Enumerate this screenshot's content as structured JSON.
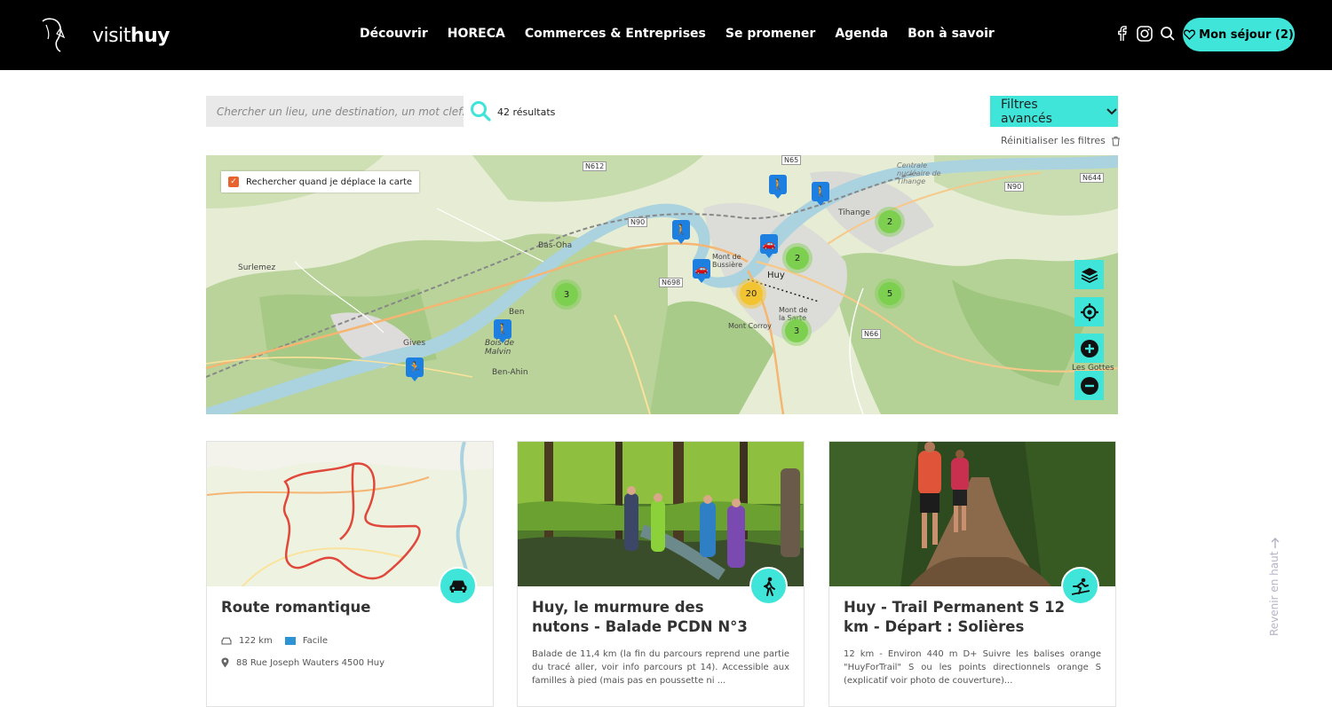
{
  "brand": {
    "logo_prefix": "visit",
    "logo_suffix": "huy"
  },
  "nav": {
    "items": [
      "Découvrir",
      "HORECA",
      "Commerces & Entreprises",
      "Se promener",
      "Agenda",
      "Bon à savoir"
    ]
  },
  "header": {
    "icons": [
      "facebook-icon",
      "instagram-icon",
      "search-icon"
    ],
    "sejour_label": "Mon séjour (2)"
  },
  "search": {
    "placeholder": "Chercher un lieu, une destination, un mot clef...",
    "results": "42 résultats",
    "filters_label": "Filtres avancés",
    "reset_label": "Réinitialiser les filtres"
  },
  "map": {
    "checkbox_label": "Rechercher quand je déplace la carte",
    "places": [
      "Surlemez",
      "Bas-Oha",
      "Ben",
      "Gives",
      "Bois de Malvin",
      "Ben-Ahin",
      "Huy",
      "Mont de Bussière",
      "Mont de la Sarte",
      "Mont Corroy",
      "Tihange",
      "Centrale nucléaire de Tihange",
      "Les Gottes"
    ],
    "roads": [
      "N612",
      "N90",
      "N698",
      "N65",
      "N90",
      "N644",
      "N66"
    ],
    "clusters": [
      "3",
      "2",
      "2",
      "20",
      "5",
      "3"
    ],
    "colors": {
      "cluster": "#7ccf4f",
      "cluster_big": "#f3c432",
      "marker": "#1d7fe0",
      "accent": "#3ee5d8"
    }
  },
  "cards": [
    {
      "title": "Route romantique",
      "badge_icon": "car-icon",
      "distance": "122 km",
      "difficulty": "Facile",
      "address": "88 Rue Joseph Wauters 4500 Huy"
    },
    {
      "title": "Huy, le murmure des nutons - Balade PCDN N°3",
      "badge_icon": "hiker-icon",
      "description": "Balade de 11,4 km (la fin du parcours reprend une partie du tracé aller, voir info parcours pt 14). Accessible aux familles à pied (mais pas en poussette ni ..."
    },
    {
      "title": "Huy - Trail Permanent S 12 km - Départ : Solières",
      "badge_icon": "runner-icon",
      "description": "12 km - Environ 440 m D+ Suivre les balises orange \"HuyForTrail\" S ou les points directionnels orange S (explicatif voir photo de couverture)..."
    }
  ],
  "back_to_top": "Revenir en haut"
}
